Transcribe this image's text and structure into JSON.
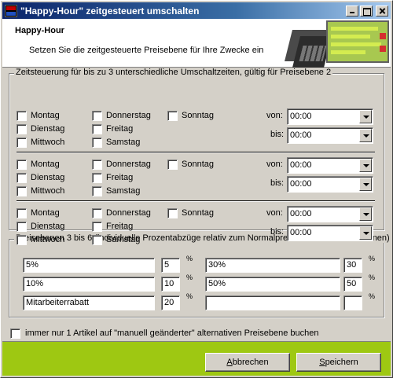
{
  "window": {
    "title": "\"Happy-Hour\" zeitgesteuert umschalten",
    "icon": "app-logo-icon",
    "controls": [
      "minimize-icon",
      "maximize-icon",
      "close-icon"
    ]
  },
  "header": {
    "title": "Happy-Hour",
    "subtitle": "Setzen Sie die zeitgesteuerte Preisebene für Ihre Zwecke ein"
  },
  "schedule": {
    "legend": "Zeitsteuerung für bis zu 3 unterschiedliche Umschaltzeiten, gültig für Preisebene 2",
    "days": [
      "Montag",
      "Dienstag",
      "Mittwoch",
      "Donnerstag",
      "Freitag",
      "Samstag",
      "Sonntag"
    ],
    "von_label": "von:",
    "bis_label": "bis:",
    "rows": [
      {
        "checked": [
          false,
          false,
          false,
          false,
          false,
          false,
          false
        ],
        "von": "00:00",
        "bis": "00:00"
      },
      {
        "checked": [
          false,
          false,
          false,
          false,
          false,
          false,
          false
        ],
        "von": "00:00",
        "bis": "00:00"
      },
      {
        "checked": [
          false,
          false,
          false,
          false,
          false,
          false,
          false
        ],
        "von": "00:00",
        "bis": "00:00"
      }
    ]
  },
  "price_levels": {
    "legend": "Preisebenen 3 bis 6 (individuelle Prozentabzüge relativ zum Normalpreis bei diesen Preisebenen)",
    "percent_sign": "%",
    "entries": [
      {
        "name": "5%",
        "percent": "5"
      },
      {
        "name": "30%",
        "percent": "30"
      },
      {
        "name": "10%",
        "percent": "10"
      },
      {
        "name": "50%",
        "percent": "50"
      },
      {
        "name": "Mitarbeiterrabatt",
        "percent": "20"
      },
      {
        "name": "",
        "percent": ""
      }
    ]
  },
  "option": {
    "label": "immer nur 1 Artikel auf  \"manuell geänderter\" alternativen Preisebene buchen",
    "checked": false
  },
  "footer": {
    "cancel_label": "Abbrechen",
    "cancel_mnemonic": "A",
    "cancel_rest": "bbrechen",
    "save_label": "Speichern",
    "save_mnemonic": "S",
    "save_rest": "peichern",
    "accent": "#9ec812"
  }
}
